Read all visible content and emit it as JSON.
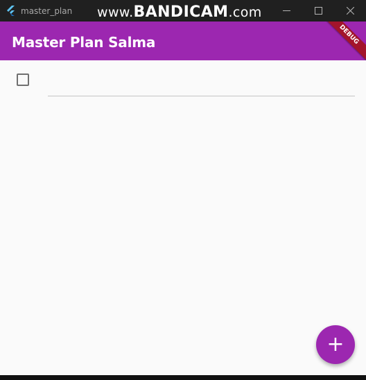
{
  "window": {
    "title": "master_plan",
    "watermark_prefix": "www.",
    "watermark_brand": "BANDICAM",
    "watermark_suffix": ".com",
    "minimize_icon": "minimize-icon",
    "maximize_icon": "maximize-icon",
    "close_icon": "close-icon"
  },
  "appbar": {
    "title": "Master Plan Salma",
    "debug_label": "DEBUG",
    "color": "#9c27b0"
  },
  "tasks": [
    {
      "checked": false,
      "description": ""
    }
  ],
  "fab": {
    "icon": "add-icon",
    "glyph": "+",
    "color": "#9c27b0"
  }
}
